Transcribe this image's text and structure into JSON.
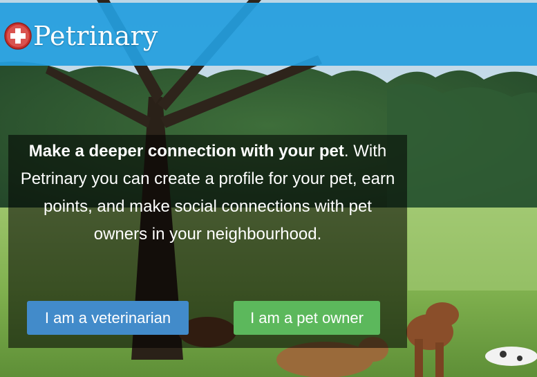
{
  "brand": {
    "name": "Petrinary",
    "logo_icon": "red-cross-badge-icon"
  },
  "intro": {
    "lead": "Make a deeper connection with your pet",
    "lead_punctuation": ".",
    "body": " With Petrinary you can create a profile for your pet, earn points, and make social connections with pet owners in your neighbourhood."
  },
  "actions": {
    "veterinarian_label": "I am a veterinarian",
    "pet_owner_label": "I am a pet owner"
  },
  "colors": {
    "navbar": "#249ede",
    "veterinarian_button": "#428bca",
    "pet_owner_button": "#5cb85c",
    "panel_overlay": "rgba(0,0,0,0.55)"
  }
}
